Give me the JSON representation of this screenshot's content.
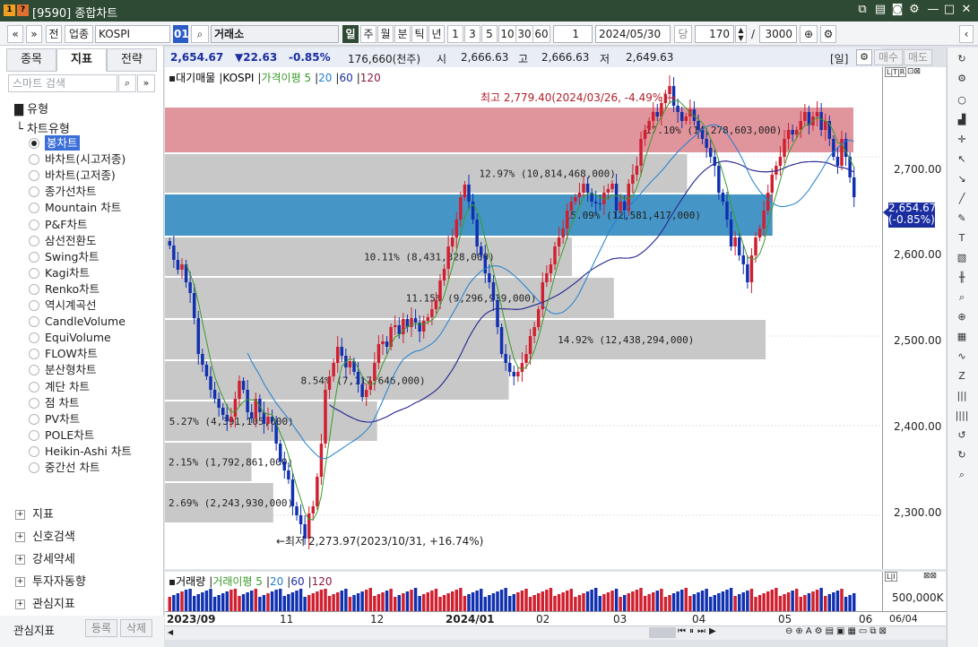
{
  "window": {
    "title": "[9590] 종합차트",
    "icon": "1",
    "icon2": "?"
  },
  "toolbar": {
    "nav_prev": "«",
    "nav_down": "»",
    "btn_prev": "전",
    "btn_sector": "업종",
    "symbol": "KOSPI",
    "code": "01",
    "exchange": "거래소",
    "periods": [
      "일",
      "주",
      "월",
      "분",
      "틱",
      "년"
    ],
    "selected_period": "일",
    "minutes": [
      "1",
      "3",
      "5",
      "10",
      "30",
      "60"
    ],
    "interval_value": "1",
    "date": "2024/05/30",
    "day_label": "당",
    "count": "170",
    "slash": "/",
    "total": "3000"
  },
  "left_panel": {
    "tabs": [
      "종목",
      "지표",
      "전략"
    ],
    "selected_tab": "지표",
    "search_placeholder": "스마트 검색",
    "section_type": "유형",
    "chart_type_header": "차트유형",
    "chart_types": [
      "봉차트",
      "바차트(시고저종)",
      "바차트(고저종)",
      "종가선차트",
      "Mountain 차트",
      "P&F차트",
      "삼선전환도",
      "Swing차트",
      "Kagi차트",
      "Renko차트",
      "역시계곡선",
      "CandleVolume",
      "EquiVolume",
      "FLOW차트",
      "분산형차트",
      "계단 차트",
      "점 차트",
      "PV차트",
      "POLE차트",
      "Heikin-Ashi 차트",
      "중간선 차트"
    ],
    "selected_chart_type": "봉차트",
    "groups": [
      "지표",
      "신호검색",
      "강세약세",
      "투자자동향",
      "관심지표"
    ],
    "footer_label": "관심지표",
    "footer_buttons": [
      "등록",
      "삭제"
    ]
  },
  "info_bar": {
    "price": "2,654.67",
    "change": "▼22.63",
    "pct": "-0.85%",
    "volume": "176,660(천주)",
    "open_label": "시",
    "open": "2,666.63",
    "high_label": "고",
    "high": "2,666.63",
    "low_label": "저",
    "low": "2,649.63",
    "period": "[일]",
    "buy": "매수",
    "sell": "매도"
  },
  "legend": {
    "items": [
      "대기매물",
      "KOSPI",
      "가격이평 5",
      "20",
      "60",
      "120"
    ],
    "colors": [
      "#000000",
      "#000000",
      "#3a9a2a",
      "#1f7fd0",
      "#1a2ea0",
      "#8b1a3a"
    ]
  },
  "volume_legend": {
    "items": [
      "거래량",
      "거래이평 5",
      "20",
      "60",
      "120"
    ],
    "colors": [
      "#000000",
      "#3a9a2a",
      "#1f7fd0",
      "#1a2ea0",
      "#8b1a3a"
    ]
  },
  "y_axis": {
    "labels": [
      "2,700.00",
      "2,600.00",
      "2,500.00",
      "2,400.00",
      "2,300.00"
    ],
    "current_price": "2,654.67",
    "current_pct": "(-0.85%)",
    "volume_label": "500,000K"
  },
  "x_axis": {
    "labels": [
      "2023/09",
      "11",
      "12",
      "2024/01",
      "02",
      "03",
      "04",
      "05",
      "06"
    ],
    "date_right": "06/04"
  },
  "annotations": {
    "high": "최고 2,779.40(2024/03/26, -4.49%)→",
    "low": "←최저 2,273.97(2023/10/31, +16.74%)"
  },
  "chart_data": {
    "type": "candlestick",
    "price_range": [
      2250,
      2790
    ],
    "volume_profile": [
      {
        "label": "17.10% (14,278,603,000)",
        "pct": 17.1,
        "low": 2705,
        "high": 2755,
        "color": "#e0949c"
      },
      {
        "label": "12.97% (10,814,468,000)",
        "pct": 12.97,
        "low": 2660,
        "high": 2703,
        "color": "#c8c8c8"
      },
      {
        "label": "15.09% (12,581,417,000)",
        "pct": 15.09,
        "low": 2612,
        "high": 2658,
        "color": "#4596c6"
      },
      {
        "label": "10.11% (8,431,328,000)",
        "pct": 10.11,
        "low": 2567,
        "high": 2610,
        "color": "#c8c8c8"
      },
      {
        "label": "11.15% (9,296,939,000)",
        "pct": 11.15,
        "low": 2520,
        "high": 2565,
        "color": "#c8c8c8"
      },
      {
        "label": "14.92% (12,438,294,000)",
        "pct": 14.92,
        "low": 2474,
        "high": 2518,
        "color": "#c8c8c8"
      },
      {
        "label": "8.54% (7,117,646,000)",
        "pct": 8.54,
        "low": 2429,
        "high": 2472,
        "color": "#c8c8c8"
      },
      {
        "label": "5.27% (4,391,105,000)",
        "pct": 5.27,
        "low": 2383,
        "high": 2427,
        "color": "#c8c8c8"
      },
      {
        "label": "2.15% (1,792,861,000)",
        "pct": 2.15,
        "low": 2338,
        "high": 2381,
        "color": "#c8c8c8"
      },
      {
        "label": "2.69% (2,243,930,000)",
        "pct": 2.69,
        "low": 2292,
        "high": 2336,
        "color": "#c8c8c8"
      }
    ],
    "closes": [
      2601,
      2585,
      2574,
      2580,
      2560,
      2548,
      2520,
      2480,
      2468,
      2455,
      2440,
      2430,
      2420,
      2412,
      2405,
      2410,
      2430,
      2450,
      2440,
      2415,
      2408,
      2430,
      2415,
      2402,
      2410,
      2405,
      2380,
      2360,
      2350,
      2340,
      2310,
      2300,
      2290,
      2274,
      2302,
      2310,
      2343,
      2380,
      2440,
      2455,
      2470,
      2488,
      2478,
      2465,
      2472,
      2460,
      2446,
      2432,
      2440,
      2450,
      2470,
      2491,
      2494,
      2488,
      2510,
      2512,
      2502,
      2519,
      2510,
      2520,
      2515,
      2505,
      2517,
      2521,
      2530,
      2540,
      2562,
      2575,
      2600,
      2610,
      2630,
      2655,
      2669,
      2650,
      2630,
      2600,
      2590,
      2570,
      2560,
      2540,
      2510,
      2480,
      2470,
      2460,
      2455,
      2460,
      2470,
      2480,
      2500,
      2510,
      2530,
      2560,
      2570,
      2580,
      2600,
      2610,
      2620,
      2640,
      2650,
      2655,
      2660,
      2670,
      2660,
      2650,
      2648,
      2647,
      2660,
      2664,
      2670,
      2640,
      2650,
      2640,
      2670,
      2680,
      2690,
      2720,
      2730,
      2740,
      2750,
      2745,
      2760,
      2770,
      2779,
      2757,
      2750,
      2740,
      2745,
      2753,
      2740,
      2730,
      2720,
      2710,
      2700,
      2690,
      2660,
      2650,
      2630,
      2600,
      2610,
      2590,
      2580,
      2560,
      2590,
      2610,
      2620,
      2640,
      2660,
      2680,
      2690,
      2700,
      2720,
      2730,
      2725,
      2730,
      2740,
      2750,
      2735,
      2745,
      2750,
      2730,
      2740,
      2720,
      2700,
      2690,
      2720,
      2700,
      2677,
      2655
    ],
    "ma": {
      "5": "#3a9a2a",
      "20": "#1f7fd0",
      "60": "#1a2ea0",
      "120": "#8b1a3a"
    }
  }
}
